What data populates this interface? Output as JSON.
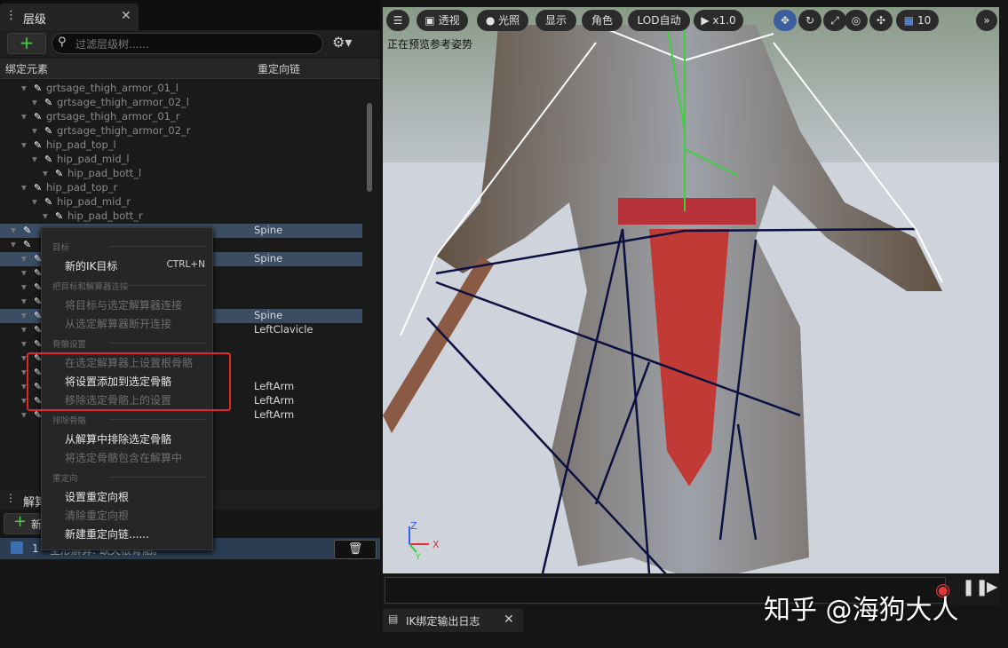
{
  "hierarchy": {
    "tab_label": "层级",
    "search_placeholder": "过滤层级树......",
    "col_element": "绑定元素",
    "col_chain": "重定向链",
    "rows": [
      {
        "name": "grtsage_thigh_armor_01_l",
        "chain": ""
      },
      {
        "name": "grtsage_thigh_armor_02_l",
        "chain": ""
      },
      {
        "name": "grtsage_thigh_armor_01_r",
        "chain": ""
      },
      {
        "name": "grtsage_thigh_armor_02_r",
        "chain": ""
      },
      {
        "name": "hip_pad_top_l",
        "chain": ""
      },
      {
        "name": "hip_pad_mid_l",
        "chain": ""
      },
      {
        "name": "hip_pad_bott_l",
        "chain": ""
      },
      {
        "name": "hip_pad_top_r",
        "chain": ""
      },
      {
        "name": "hip_pad_mid_r",
        "chain": ""
      },
      {
        "name": "hip_pad_bott_r",
        "chain": ""
      },
      {
        "name": "",
        "chain": "Spine"
      },
      {
        "name": "",
        "chain": ""
      },
      {
        "name": "",
        "chain": "Spine"
      },
      {
        "name": "",
        "chain": ""
      },
      {
        "name": "",
        "chain": ""
      },
      {
        "name": "",
        "chain": ""
      },
      {
        "name": "",
        "chain": "Spine"
      },
      {
        "name": "",
        "chain": "LeftClavicle"
      },
      {
        "name": "",
        "chain": ""
      },
      {
        "name": "",
        "chain": ""
      },
      {
        "name": "",
        "chain": ""
      },
      {
        "name": "",
        "chain": "LeftArm"
      },
      {
        "name": "",
        "chain": "LeftArm"
      },
      {
        "name": "",
        "chain": "LeftArm"
      }
    ]
  },
  "solver": {
    "header": "解算",
    "new_label": "新",
    "item_num": "1",
    "item_text": "全形解算: 缺失根骨骼。"
  },
  "context_menu": {
    "sec_target": "目标",
    "new_ik_target": "新的IK目标",
    "new_ik_shortcut": "CTRL+N",
    "sec_connect": "把目标和解算器连接",
    "connect": "将目标与选定解算器连接",
    "disconnect": "从选定解算器断开连接",
    "sec_bone_settings": "骨骼设置",
    "set_root": "在选定解算器上设置根骨骼",
    "add_settings": "将设置添加到选定骨骼",
    "remove_settings": "移除选定骨骼上的设置",
    "sec_exclude": "排除骨骼",
    "exclude": "从解算中排除选定骨骼",
    "include": "将选定骨骼包含在解算中",
    "sec_retarget": "重定向",
    "set_retarget_root": "设置重定向根",
    "clear_retarget_root": "清除重定向根",
    "new_chain": "新建重定向链......"
  },
  "viewport": {
    "perspective": "透视",
    "lighting": "光照",
    "show": "显示",
    "character": "角色",
    "lod": "LOD自动",
    "speed": "x1.0",
    "grid_value": "10",
    "overlay_text": "正在预览参考姿势",
    "axis_x": "X",
    "axis_y": "Y",
    "axis_z": "Z"
  },
  "log_tab": "IK绑定输出日志",
  "watermark": "知乎 @海狗大人"
}
